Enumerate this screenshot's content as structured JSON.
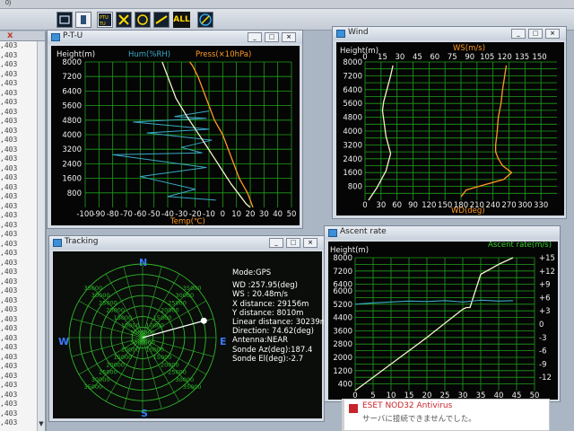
{
  "app": {
    "menu_fragment": "0)"
  },
  "toolbar": {
    "buttons": [
      "view-icon",
      "document-icon",
      "ptu-icon",
      "grid-icon",
      "wind-icon",
      "ascent-icon",
      "all-button",
      "tracking-icon"
    ],
    "all_label": "ALL"
  },
  "left_column": {
    "close_glyph": "x",
    "values": [
      ",403",
      ",403",
      ",403",
      ",403",
      ",403",
      ",403",
      ",403",
      ",403",
      ",403",
      ",403",
      ",403",
      ",403",
      ",403",
      ",403",
      ",403",
      ",403",
      ",403",
      ",403",
      ",403",
      ",403",
      ",403",
      ",403",
      ",403",
      ",403",
      ",403",
      ",403",
      ",403",
      ",403",
      ",403",
      ",403",
      ",403",
      ",403",
      ",403",
      ",403",
      ",403",
      ",403",
      ",403",
      ",403",
      ",403",
      ",403",
      ",403"
    ]
  },
  "colors": {
    "grid": "#1fa01a",
    "plot_bg": "#050505",
    "temp": "#f2f2c8",
    "hum": "#3aa9c7",
    "press": "#ff9a22",
    "ws": "#f2f2c8",
    "wd": "#ff9a22",
    "height_line": "#f2f2c8",
    "ascent_rate": "#3aa9c7",
    "accent_green": "#2fb82a",
    "antivirus_red": "#c7242b"
  },
  "ptu": {
    "title": "P-T-U",
    "ylabel": "Height(m)",
    "hum_label": "Hum(%RH)",
    "press_label": "Press(×10hPa)",
    "xlabel": "Temp(℃)"
  },
  "wind": {
    "title": "Wind",
    "ylabel": "Height(m)",
    "ws_label": "WS(m/s)",
    "xlabel": "WD(deg)"
  },
  "tracking": {
    "title": "Tracking",
    "mode": "Mode:GPS",
    "wd": "WD   :257.95(deg)",
    "ws": "WS   : 20.48m/s",
    "x_distance": "X distance: 29156m",
    "y_distance": "Y distance:   8010m",
    "linear_distance": "Linear distance: 30239m",
    "direction": "Direction: 74.62(deg)",
    "antenna": "Antenna:NEAR",
    "sonde_az": "Sonde Az(deg):187.4",
    "sonde_el": "Sonde El(deg):-2.7",
    "compass": {
      "n": "N",
      "s": "S",
      "e": "E",
      "w": "W"
    },
    "ring_labels": [
      "5000",
      "10000",
      "15000",
      "20000",
      "25000",
      "30000",
      "35000"
    ]
  },
  "ascent": {
    "title": "Ascent rate",
    "ylabel": "Height(m)",
    "rate_label": "Ascent rate(m/s)"
  },
  "antivirus": {
    "title": "ESET NOD32 Antivirus",
    "message": "サーバに接続できませんでした。"
  },
  "chart_data": [
    {
      "type": "line",
      "name": "P-T-U",
      "ylabel": "Height(m)",
      "xlabel": "Temp(℃)",
      "ylim": [
        0,
        8000
      ],
      "xlim": [
        -100,
        50
      ],
      "y_ticks": [
        800,
        1600,
        2400,
        3200,
        4000,
        4800,
        5600,
        6400,
        7200,
        8000
      ],
      "x_ticks": [
        -100,
        -90,
        -80,
        -70,
        -60,
        -50,
        -40,
        -30,
        -20,
        -10,
        0,
        10,
        20,
        30,
        40,
        50
      ],
      "grid": true,
      "series": [
        {
          "name": "Temp(℃)",
          "x": [
            20,
            17,
            12,
            6,
            0,
            -6,
            -12,
            -19,
            -26,
            -34,
            -44
          ],
          "y": [
            0,
            200,
            700,
            1300,
            2000,
            2700,
            3400,
            4200,
            5000,
            6000,
            8000
          ]
        },
        {
          "name": "Hum(%RH)",
          "x": [
            -5,
            -40,
            -20,
            -60,
            -12,
            -80,
            -15,
            -30,
            -8,
            -55,
            -10,
            -65,
            -12,
            -35,
            -10
          ],
          "y": [
            400,
            600,
            1000,
            1700,
            2200,
            2900,
            3000,
            3300,
            3700,
            4100,
            4300,
            4700,
            4900,
            5000,
            5300
          ]
        },
        {
          "name": "Press(×10hPa)",
          "x": [
            22,
            18,
            12,
            8,
            4,
            0,
            -6,
            -10,
            -14,
            -18,
            -22,
            -24
          ],
          "y": [
            0,
            800,
            1600,
            2400,
            3200,
            4000,
            4800,
            5600,
            6400,
            7200,
            7800,
            8000
          ]
        }
      ]
    },
    {
      "type": "line",
      "name": "Wind",
      "ylabel": "Height(m)",
      "xlabel": "WD(deg)",
      "ylim": [
        0,
        8000
      ],
      "x_ticks_ws": [
        0,
        15,
        30,
        45,
        60,
        75,
        90,
        105,
        120,
        135,
        150
      ],
      "x_ticks_wd": [
        0,
        30,
        60,
        90,
        120,
        150,
        180,
        210,
        240,
        270,
        300,
        330
      ],
      "y_ticks": [
        400,
        800,
        1200,
        1600,
        2000,
        2400,
        2800,
        3200,
        3600,
        4000,
        4400,
        4800,
        5200,
        5600,
        6000,
        6400,
        6800,
        7200,
        7600,
        8000
      ],
      "grid": true,
      "series": [
        {
          "name": "WS(m/s)",
          "x": [
            3,
            6,
            10,
            14,
            18,
            20,
            22,
            20,
            18,
            17,
            16,
            15,
            16,
            18,
            20,
            22,
            24
          ],
          "y": [
            0,
            300,
            700,
            1200,
            1700,
            2200,
            2700,
            3200,
            3700,
            4200,
            4700,
            5200,
            5700,
            6200,
            6700,
            7200,
            7800
          ]
        },
        {
          "name": "WD(deg)",
          "x": [
            180,
            190,
            225,
            260,
            275,
            258,
            250,
            245,
            245,
            248,
            250,
            255,
            258,
            262,
            265
          ],
          "y": [
            200,
            600,
            900,
            1200,
            1600,
            2000,
            2400,
            2800,
            3200,
            4000,
            4800,
            5600,
            6400,
            7200,
            7800
          ]
        }
      ]
    },
    {
      "type": "line",
      "name": "Ascent rate",
      "ylabel": "Height(m)",
      "ylim": [
        0,
        8000
      ],
      "y_ticks": [
        400,
        1200,
        2000,
        2800,
        3600,
        4400,
        5200,
        6000,
        6400,
        7200,
        8000
      ],
      "x_ticks": [
        0,
        5,
        10,
        15,
        20,
        25,
        30,
        35,
        40,
        45,
        50
      ],
      "y2_ticks": [
        -12,
        -9,
        -6,
        -3,
        0,
        3,
        6,
        9,
        12,
        15
      ],
      "grid": true,
      "series": [
        {
          "name": "Height",
          "x": [
            0,
            10,
            20,
            30,
            31,
            32,
            35,
            40,
            44
          ],
          "y": [
            0,
            1600,
            3200,
            4900,
            5000,
            5000,
            7000,
            7600,
            8000
          ]
        },
        {
          "name": "Ascent rate(m/s)",
          "x": [
            0,
            5,
            10,
            15,
            20,
            25,
            30,
            35,
            40,
            44
          ],
          "y": [
            4.5,
            4.8,
            5.0,
            5.2,
            5.1,
            5.3,
            5.0,
            5.4,
            5.2,
            5.3
          ]
        }
      ]
    }
  ]
}
